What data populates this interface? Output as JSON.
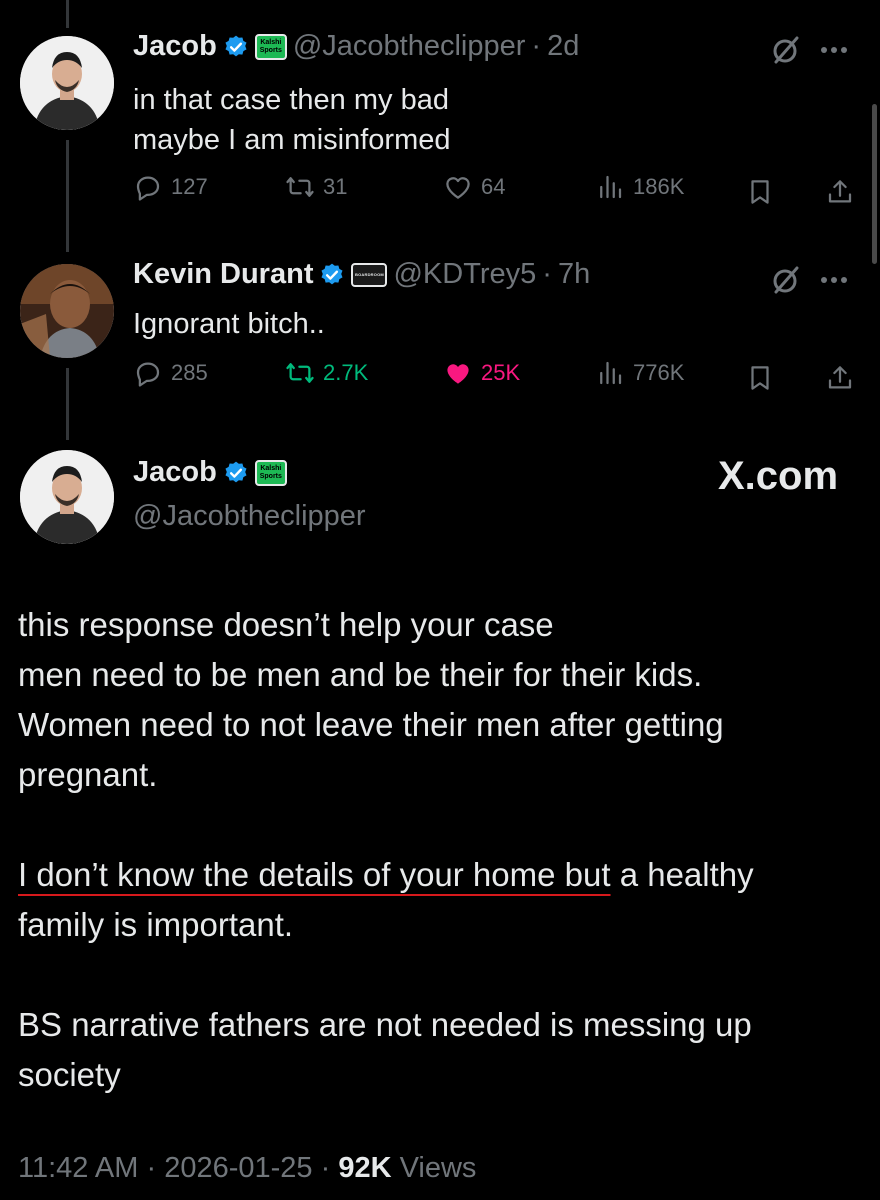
{
  "tweets": [
    {
      "name": "Jacob",
      "badge": "Kalshi Sports",
      "handle": "@Jacobtheclipper",
      "sep": "·",
      "time": "2d",
      "lines": [
        "in that case then my bad",
        "maybe I am misinformed"
      ],
      "stats": {
        "replies": "127",
        "retweets": "31",
        "likes": "64",
        "views": "186K"
      }
    },
    {
      "name": "Kevin Durant",
      "badge": "BOARDROOM",
      "handle": "@KDTrey5",
      "sep": "·",
      "time": "7h",
      "lines": [
        "Ignorant bitch.."
      ],
      "stats": {
        "replies": "285",
        "retweets": "2.7K",
        "likes": "25K",
        "views": "776K"
      }
    }
  ],
  "main_tweet": {
    "name": "Jacob",
    "badge": "Kalshi Sports",
    "handle": "@Jacobtheclipper",
    "watermark": "X.com",
    "paragraphs": [
      "this response doesn’t help your case\nmen need to be men and be their for their kids.\nWomen need to not leave their men after getting\npregnant.",
      {
        "underlined": "I don’t know the details of your home but",
        "rest": " a healthy\nfamily is important."
      },
      "BS narrative fathers are not needed is messing up\nsociety"
    ],
    "footer": {
      "time": "11:42 AM",
      "date": "2026-01-25",
      "views_count": "92K",
      "views_label": "Views",
      "sep": "·"
    }
  },
  "icons": [
    "verified-icon",
    "grok-icon",
    "more-icon",
    "reply-icon",
    "retweet-icon",
    "like-icon",
    "views-icon",
    "bookmark-icon",
    "share-icon"
  ],
  "colors": {
    "background": "#000000",
    "text": "#e7e9ea",
    "muted": "#71767b",
    "verified": "#1d9bf0",
    "like": "#f91880",
    "retweet": "#00ba7c",
    "underline": "#d7191c"
  }
}
